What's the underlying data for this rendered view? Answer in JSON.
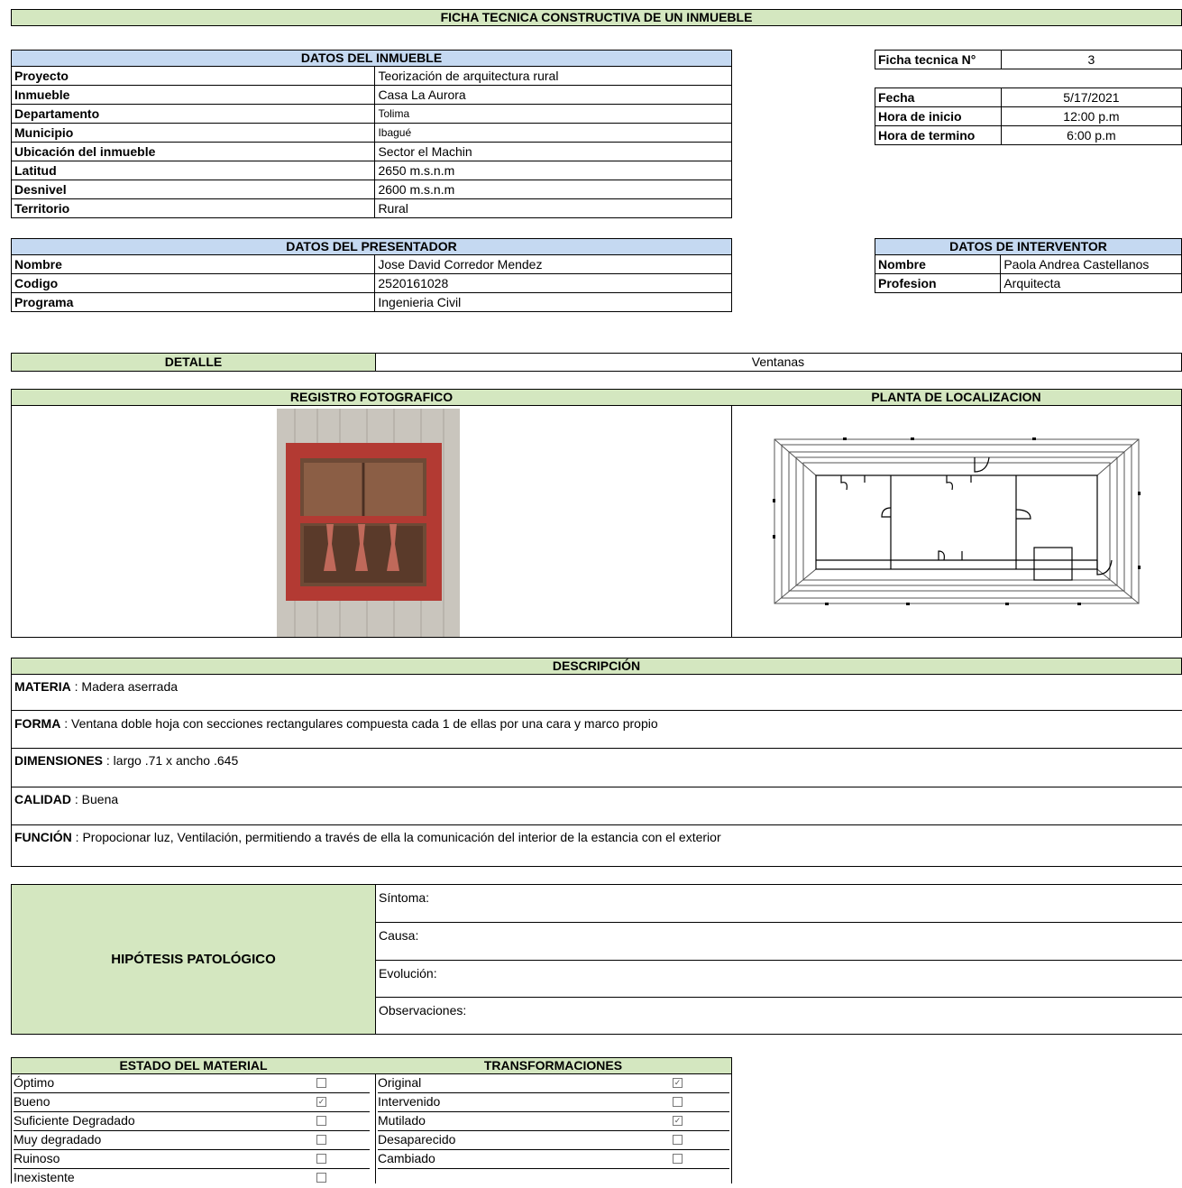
{
  "title": "FICHA TECNICA CONSTRUCTIVA DE UN INMUEBLE",
  "inmueble": {
    "header": "DATOS DEL INMUEBLE",
    "rows": [
      {
        "label": "Proyecto",
        "value": "Teorización de arquitectura rural"
      },
      {
        "label": "Inmueble",
        "value": "Casa La Aurora"
      },
      {
        "label": "Departamento",
        "value": "Tolima"
      },
      {
        "label": "Municipio",
        "value": "Ibagué"
      },
      {
        "label": "Ubicación del inmueble",
        "value": "Sector el Machin"
      },
      {
        "label": "Latitud",
        "value": "2650 m.s.n.m"
      },
      {
        "label": "Desnivel",
        "value": "2600 m.s.n.m"
      },
      {
        "label": "Territorio",
        "value": "Rural"
      }
    ]
  },
  "ficha": {
    "label": "Ficha tecnica N°",
    "value": "3",
    "rows": [
      {
        "label": "Fecha",
        "value": "5/17/2021"
      },
      {
        "label": "Hora de inicio",
        "value": "12:00 p.m"
      },
      {
        "label": "Hora de termino",
        "value": "6:00 p.m"
      }
    ]
  },
  "presentador": {
    "header": "DATOS DEL PRESENTADOR",
    "rows": [
      {
        "label": "Nombre",
        "value": "Jose David Corredor Mendez"
      },
      {
        "label": "Codigo",
        "value": "2520161028"
      },
      {
        "label": "Programa",
        "value": "Ingenieria Civil"
      }
    ]
  },
  "interventor": {
    "header": "DATOS DE INTERVENTOR",
    "rows": [
      {
        "label": "Nombre",
        "value": "Paola Andrea Castellanos"
      },
      {
        "label": "Profesion",
        "value": "Arquitecta"
      }
    ]
  },
  "detalle": {
    "label": "DETALLE",
    "value": "Ventanas"
  },
  "registro_header": "REGISTRO FOTOGRAFICO",
  "planta_header": "PLANTA DE LOCALIZACION",
  "descripcion": {
    "header": "DESCRIPCIÓN",
    "rows": [
      {
        "label": "MATERIA",
        "value": " : Madera aserrada"
      },
      {
        "label": "FORMA",
        "value": " :  Ventana doble hoja con secciones rectangulares compuesta cada 1 de ellas por una cara y marco propio"
      },
      {
        "label": "DIMENSIONES",
        "value": " : largo .71 x ancho .645"
      },
      {
        "label": "CALIDAD",
        "value": " : Buena"
      },
      {
        "label": "FUNCIÓN",
        "value": " :  Propocionar luz, Ventilación, permitiendo a través de ella la comunicación del interior de la estancia con el exterior"
      }
    ]
  },
  "hipotesis": {
    "label": "HIPÓTESIS PATOLÓGICO",
    "rows": [
      "Síntoma:",
      "Causa:",
      "Evolución:",
      "Observaciones:"
    ]
  },
  "estado": {
    "header": "ESTADO DEL MATERIAL",
    "items": [
      {
        "label": "Óptimo",
        "checked": false
      },
      {
        "label": "Bueno",
        "checked": true
      },
      {
        "label": "Suficiente Degradado",
        "checked": false
      },
      {
        "label": "Muy degradado",
        "checked": false
      },
      {
        "label": "Ruinoso",
        "checked": false
      },
      {
        "label": "Inexistente",
        "checked": false
      }
    ]
  },
  "transformaciones": {
    "header": "TRANSFORMACIONES",
    "items": [
      {
        "label": "Original",
        "checked": true
      },
      {
        "label": "Intervenido",
        "checked": false
      },
      {
        "label": "Mutilado",
        "checked": true
      },
      {
        "label": "Desaparecido",
        "checked": false
      },
      {
        "label": "Cambiado",
        "checked": false
      }
    ]
  }
}
